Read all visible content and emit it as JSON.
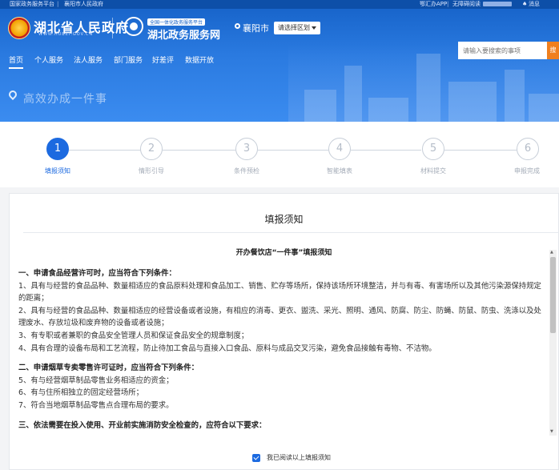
{
  "topbar": {
    "left_links": [
      "国家政务服务平台",
      "襄阳市人民政府"
    ],
    "right_links": [
      "鄂汇办APP",
      "无障碍阅读",
      "消息"
    ]
  },
  "header": {
    "site_title": "湖北省人民政府",
    "site_subtitle": "WWW.HUBEI.GOV.CN",
    "svc_tag": "全国一体化政务服务平台",
    "svc_title": "湖北政务服务网",
    "city": "襄阳市",
    "region_select": "请选择区划"
  },
  "nav": [
    "首页",
    "个人服务",
    "法人服务",
    "部门服务",
    "好差评",
    "数据开放"
  ],
  "search": {
    "placeholder": "请输入要搜索的事项",
    "button": "搜"
  },
  "banner": {
    "title": "高效办成一件事"
  },
  "steps": [
    {
      "num": "1",
      "label": "填报须知",
      "active": true
    },
    {
      "num": "2",
      "label": "情形引导",
      "active": false
    },
    {
      "num": "3",
      "label": "条件预检",
      "active": false
    },
    {
      "num": "4",
      "label": "智能填表",
      "active": false
    },
    {
      "num": "5",
      "label": "材料提交",
      "active": false
    },
    {
      "num": "6",
      "label": "申报完成",
      "active": false
    }
  ],
  "card": {
    "title": "填报须知",
    "doc_title": "开办餐饮店“一件事”填报须知",
    "sections": [
      {
        "heading": "一、申请食品经营许可时，应当符合下列条件：",
        "items": [
          "1、具有与经营的食品品种、数量相适应的食品原料处理和食品加工、销售、贮存等场所，保持该场所环境整洁，并与有毒、有害场所以及其他污染源保持规定的距离；",
          "2、具有与经营的食品品种、数量相适应的经营设备或者设施，有相应的消毒、更衣、盥洗、采光、照明、通风、防腐、防尘、防蝇、防鼠、防虫、洗涤以及处理废水、存放垃圾和废弃物的设备或者设施；",
          "3、有专职或者兼职的食品安全管理人员和保证食品安全的规章制度；",
          "4、具有合理的设备布局和工艺流程，防止待加工食品与直接入口食品、原料与成品交叉污染，避免食品接触有毒物、不洁物。"
        ]
      },
      {
        "heading": "二、申请烟草专卖零售许可证时，应当符合下列条件：",
        "items": [
          "5、有与经营烟草制品零售业务相适应的资金；",
          "6、有与住所相独立的固定经营场所；",
          "7、符合当地烟草制品零售点合理布局的要求。"
        ]
      },
      {
        "heading": "三、依法需要在投入使用、开业前实施消防安全检查的，应符合以下要求：",
        "items": []
      }
    ],
    "confirm_label": "我已阅读以上填报须知",
    "confirm_checked": true
  },
  "colors": {
    "primary": "#1c6ae0",
    "header": "#1561c7",
    "search_button": "#f07f1e"
  }
}
